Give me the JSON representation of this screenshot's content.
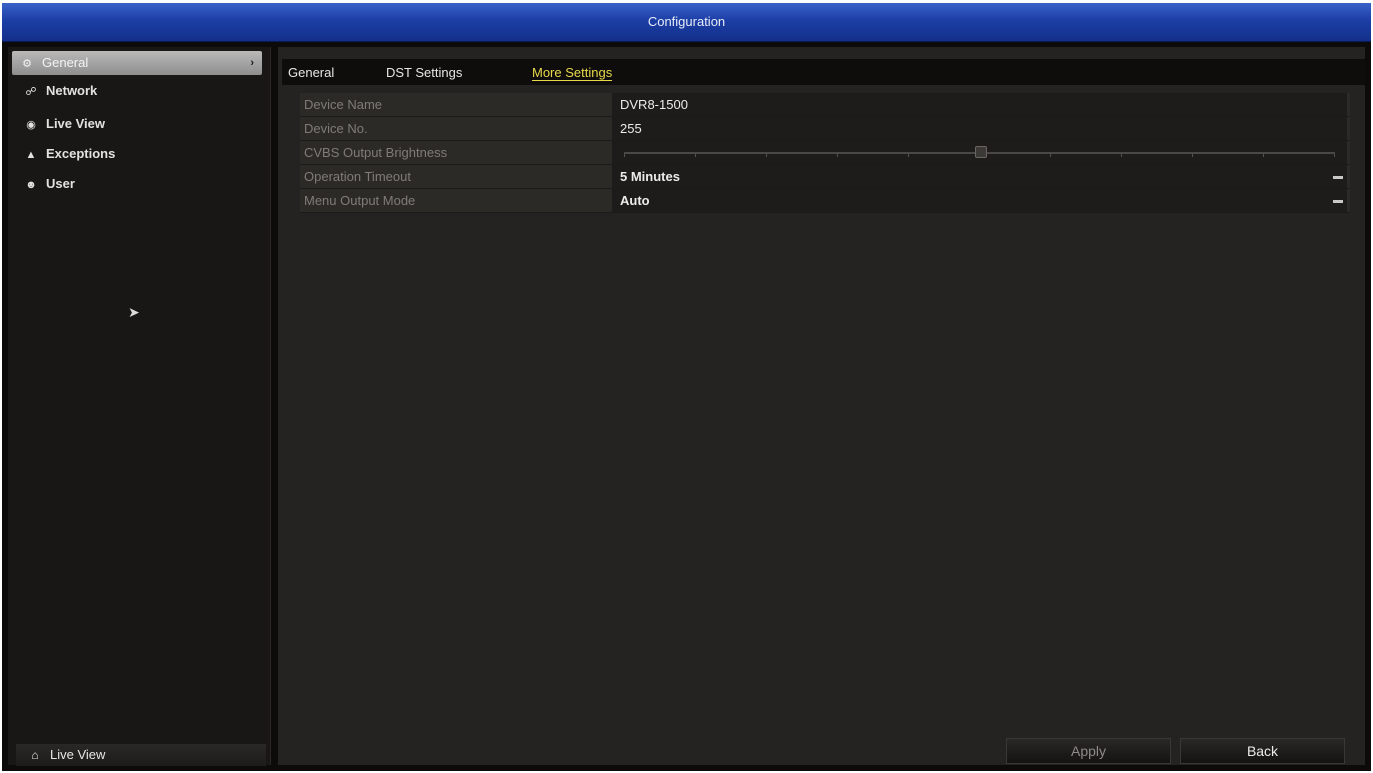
{
  "window": {
    "title": "Configuration"
  },
  "sidebar": {
    "items": [
      {
        "label": "General",
        "icon": "gear-icon",
        "active": true
      },
      {
        "label": "Network",
        "icon": "network-icon",
        "active": false
      },
      {
        "label": "Live View",
        "icon": "eye-icon",
        "active": false
      },
      {
        "label": "Exceptions",
        "icon": "warning-icon",
        "active": false
      },
      {
        "label": "User",
        "icon": "users-icon",
        "active": false
      }
    ],
    "bottom": {
      "label": "Live View",
      "icon": "home-icon"
    }
  },
  "tabs": [
    {
      "label": "General",
      "active": false
    },
    {
      "label": "DST Settings",
      "active": false
    },
    {
      "label": "More Settings",
      "active": true
    }
  ],
  "settings": [
    {
      "label": "Device Name",
      "value": "DVR8-1500",
      "control": "text"
    },
    {
      "label": "Device No.",
      "value": "255",
      "control": "text"
    },
    {
      "label": "CVBS Output Brightness",
      "control": "slider",
      "level": 0.5
    },
    {
      "label": "Operation Timeout",
      "value": "5 Minutes",
      "control": "dropdown"
    },
    {
      "label": "Menu Output Mode",
      "value": "Auto",
      "control": "dropdown"
    }
  ],
  "buttons": {
    "apply": "Apply",
    "back": "Back"
  },
  "colors": {
    "titlebar": "#1c3fa6",
    "active_tab": "#e7d94a",
    "background": "#0c0b0a"
  }
}
